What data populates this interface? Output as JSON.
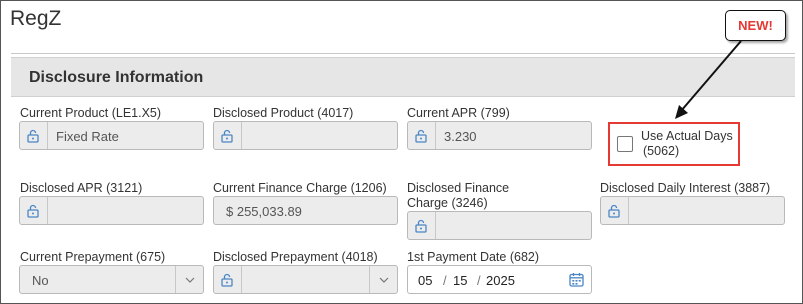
{
  "page": {
    "title": "RegZ"
  },
  "callout": {
    "text": "NEW!"
  },
  "section": {
    "title": "Disclosure Information"
  },
  "fields": {
    "current_product": {
      "label": "Current Product (LE1.X5)",
      "value": "Fixed Rate"
    },
    "disclosed_product": {
      "label": "Disclosed Product (4017)",
      "value": ""
    },
    "current_apr": {
      "label": "Current APR (799)",
      "value": "3.230"
    },
    "use_actual_days": {
      "label_line1": "Use Actual Days",
      "label_line2": "(5062)",
      "checked": false
    },
    "disclosed_apr": {
      "label": "Disclosed APR (3121)",
      "value": ""
    },
    "current_finance_charge": {
      "label": "Current Finance Charge (1206)",
      "value": "$ 255,033.89"
    },
    "disclosed_finance_charge": {
      "label_line1": "Disclosed Finance",
      "label_line2": "Charge (3246)",
      "value": ""
    },
    "disclosed_daily_interest": {
      "label": "Disclosed Daily Interest (3887)",
      "value": ""
    },
    "current_prepayment": {
      "label": "Current Prepayment (675)",
      "value": "No"
    },
    "disclosed_prepayment": {
      "label": "Disclosed Prepayment (4018)",
      "value": ""
    },
    "first_payment_date": {
      "label": "1st Payment Date (682)",
      "month": "05",
      "day": "15",
      "year": "2025",
      "sep": "/"
    }
  },
  "colors": {
    "highlight": "#e53935",
    "field_bg": "#ececec",
    "section_bg": "#e6e6e6"
  },
  "icons": {
    "lock": "unlock-icon",
    "calendar": "calendar-icon",
    "dropdown": "chevron-down-icon"
  }
}
